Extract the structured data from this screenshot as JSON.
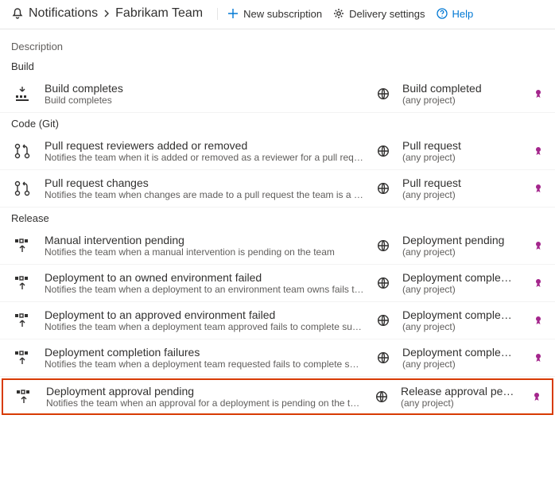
{
  "breadcrumb": {
    "root": "Notifications",
    "leaf": "Fabrikam Team"
  },
  "toolbar": {
    "new_subscription": "New subscription",
    "delivery_settings": "Delivery settings",
    "help": "Help"
  },
  "columns": {
    "description": "Description"
  },
  "groups": [
    {
      "label": "Build",
      "rows": [
        {
          "icon": "build",
          "title": "Build completes",
          "desc": "Build completes",
          "right_title": "Build completed",
          "right_sub": "(any project)"
        }
      ]
    },
    {
      "label": "Code (Git)",
      "rows": [
        {
          "icon": "pr",
          "title": "Pull request reviewers added or removed",
          "desc": "Notifies the team when it is added or removed as a reviewer for a pull request",
          "right_title": "Pull request",
          "right_sub": "(any project)"
        },
        {
          "icon": "pr",
          "title": "Pull request changes",
          "desc": "Notifies the team when changes are made to a pull request the team is a reviewer for",
          "right_title": "Pull request",
          "right_sub": "(any project)"
        }
      ]
    },
    {
      "label": "Release",
      "rows": [
        {
          "icon": "deploy",
          "title": "Manual intervention pending",
          "desc": "Notifies the team when a manual intervention is pending on the team",
          "right_title": "Deployment pending",
          "right_sub": "(any project)"
        },
        {
          "icon": "deploy",
          "title": "Deployment to an owned environment failed",
          "desc": "Notifies the team when a deployment to an environment team owns fails to complete",
          "right_title": "Deployment comple…",
          "right_sub": "(any project)"
        },
        {
          "icon": "deploy",
          "title": "Deployment to an approved environment failed",
          "desc": "Notifies the team when a deployment team approved fails to complete successfully",
          "right_title": "Deployment comple…",
          "right_sub": "(any project)"
        },
        {
          "icon": "deploy",
          "title": "Deployment completion failures",
          "desc": "Notifies the team when a deployment team requested fails to complete successfully",
          "right_title": "Deployment comple…",
          "right_sub": "(any project)"
        },
        {
          "icon": "deploy",
          "title": "Deployment approval pending",
          "desc": "Notifies the team when an approval for a deployment is pending on the team",
          "right_title": "Release approval pe…",
          "right_sub": "(any project)",
          "highlight": true
        }
      ]
    }
  ]
}
